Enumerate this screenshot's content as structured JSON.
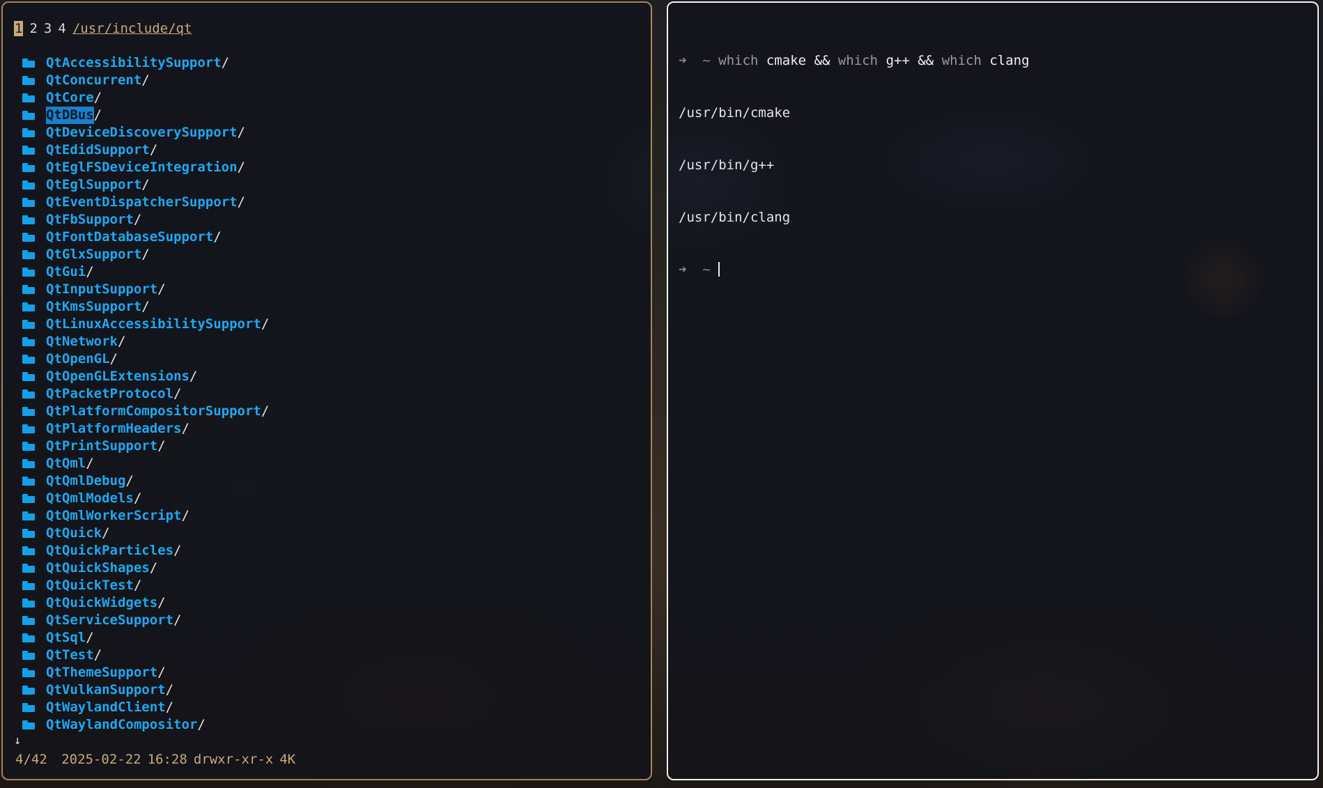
{
  "left_pane": {
    "tabs": [
      "1",
      "2",
      "3",
      "4"
    ],
    "active_tab": "1",
    "path": "/usr/include/qt",
    "entries": [
      "QtAccessibilitySupport",
      "QtConcurrent",
      "QtCore",
      "QtDBus",
      "QtDeviceDiscoverySupport",
      "QtEdidSupport",
      "QtEglFSDeviceIntegration",
      "QtEglSupport",
      "QtEventDispatcherSupport",
      "QtFbSupport",
      "QtFontDatabaseSupport",
      "QtGlxSupport",
      "QtGui",
      "QtInputSupport",
      "QtKmsSupport",
      "QtLinuxAccessibilitySupport",
      "QtNetwork",
      "QtOpenGL",
      "QtOpenGLExtensions",
      "QtPacketProtocol",
      "QtPlatformCompositorSupport",
      "QtPlatformHeaders",
      "QtPrintSupport",
      "QtQml",
      "QtQmlDebug",
      "QtQmlModels",
      "QtQmlWorkerScript",
      "QtQuick",
      "QtQuickParticles",
      "QtQuickShapes",
      "QtQuickTest",
      "QtQuickWidgets",
      "QtServiceSupport",
      "QtSql",
      "QtTest",
      "QtThemeSupport",
      "QtVulkanSupport",
      "QtWaylandClient",
      "QtWaylandCompositor"
    ],
    "selected_entry": "QtDBus",
    "dir_suffix": "/",
    "more_indicator": "↓",
    "status": {
      "position": "4/42",
      "date": "2025-02-22",
      "time": "16:28",
      "permissions": "drwxr-xr-x",
      "size": "4K"
    },
    "colors": {
      "border": "#a8835e",
      "folder": "#1fa8f0",
      "status_text": "#c8a97e"
    }
  },
  "right_pane": {
    "prompt_symbol": "➜",
    "prompt_dir": "~",
    "command": {
      "kw1": "which",
      "arg1": "cmake",
      "op1": "&&",
      "kw2": "which",
      "arg2": "g++",
      "op2": "&&",
      "kw3": "which",
      "arg3": "clang"
    },
    "output": [
      "/usr/bin/cmake",
      "/usr/bin/g++",
      "/usr/bin/clang"
    ],
    "colors": {
      "border": "#f2f2f2"
    }
  }
}
